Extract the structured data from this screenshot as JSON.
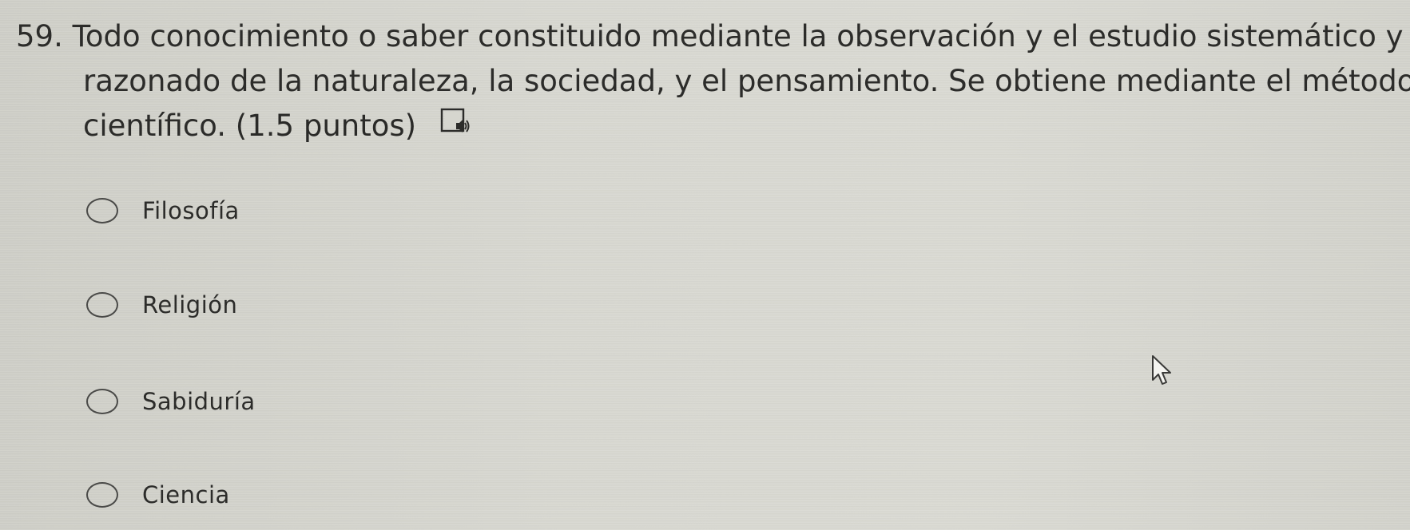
{
  "question": {
    "number": "59.",
    "line1": "Todo conocimiento o saber constituido mediante la observación y el estudio sistemático y",
    "line2": "razonado de la naturaleza, la sociedad, y el pensamiento. Se obtiene mediante el método",
    "line3": "científico.",
    "points": "(1.5 puntos)",
    "tts_icon": "text-to-speech-icon"
  },
  "options": [
    {
      "label": "Filosofía",
      "selected": false
    },
    {
      "label": "Religión",
      "selected": false
    },
    {
      "label": "Sabiduría",
      "selected": false
    },
    {
      "label": "Ciencia",
      "selected": false
    }
  ],
  "cursor_icon": "mouse-pointer-icon"
}
